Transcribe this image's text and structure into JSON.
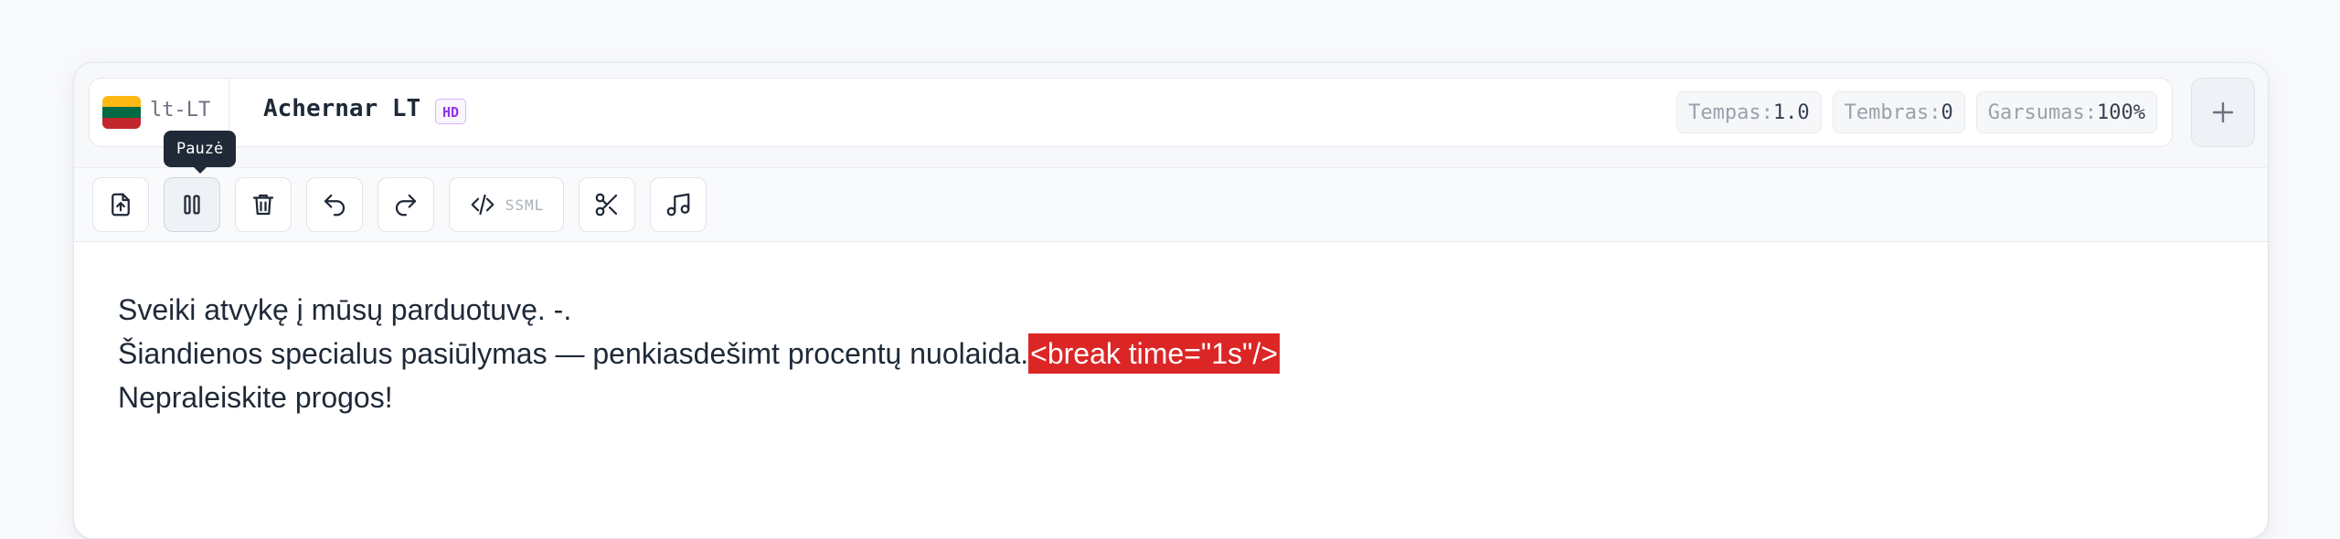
{
  "voice": {
    "locale_code": "lt-LT",
    "name": "Achernar LT",
    "badge": "HD",
    "flag_colors": [
      "#fdb913",
      "#006a44",
      "#c1272d"
    ]
  },
  "params": [
    {
      "label": "Tempas:",
      "value": "1.0"
    },
    {
      "label": "Tembras:",
      "value": "0"
    },
    {
      "label": "Garsumas:",
      "value": "100%"
    }
  ],
  "toolbar": {
    "tooltip": "Pauzė",
    "ssml_label": "SSML",
    "buttons": [
      "upload-icon",
      "pause-icon",
      "trash-icon",
      "undo-icon",
      "redo-icon",
      "code-icon",
      "scissors-icon",
      "music-icon"
    ]
  },
  "editor": {
    "line1": "Sveiki atvykę į mūsų parduotuvę. -.",
    "line2_text": "Šiandienos specialus pasiūlymas — penkiasdešimt procentų nuolaida.",
    "line2_tag": "<break time=\"1s\"/>",
    "line3": "Nepraleiskite progos!"
  },
  "colors": {
    "accent_tag": "#dc2626",
    "badge_purple": "#9333ea",
    "tooltip_bg": "#1f2937"
  }
}
